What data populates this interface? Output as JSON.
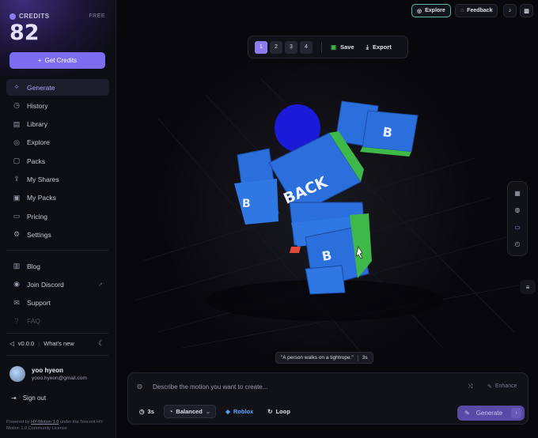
{
  "sidebar": {
    "credits": {
      "label": "CREDITS",
      "plan": "FREE",
      "count": "82",
      "cta": "Get Credits"
    },
    "nav": [
      {
        "label": "Generate",
        "icon": "sparkle-icon",
        "active": true
      },
      {
        "label": "History",
        "icon": "history-icon"
      },
      {
        "label": "Library",
        "icon": "library-icon"
      },
      {
        "label": "Explore",
        "icon": "compass-icon"
      },
      {
        "label": "Packs",
        "icon": "box-icon"
      },
      {
        "label": "My Shares",
        "icon": "share-icon"
      },
      {
        "label": "My Packs",
        "icon": "packs-icon"
      },
      {
        "label": "Pricing",
        "icon": "pricing-icon"
      },
      {
        "label": "Settings",
        "icon": "gear-icon"
      }
    ],
    "nav2": [
      {
        "label": "Blog",
        "icon": "book-icon"
      },
      {
        "label": "Join Discord",
        "icon": "discord-icon"
      },
      {
        "label": "Support",
        "icon": "mail-icon"
      },
      {
        "label": "FAQ",
        "icon": "help-icon"
      }
    ],
    "version": "v0.0.0",
    "whats_new": "What's new",
    "user": {
      "name": "yoo hyeon",
      "email": "yooo.hyeon@gmail.com"
    },
    "sign_out": "Sign out",
    "powered_prefix": "Powered by",
    "powered_link": "HY-Motion 1.0",
    "powered_suffix": "under the Tencent HY-Motion 1.0 Community License"
  },
  "topbar": {
    "explore": "Explore",
    "feedback": "Feedback"
  },
  "toolbar": {
    "pages": [
      "1",
      "2",
      "3",
      "4"
    ],
    "selected_page": "1",
    "save": "Save",
    "export": "Export"
  },
  "scene": {
    "label_back": "BACK",
    "label_b": "B"
  },
  "caption": {
    "text": "\"A person walks on a tightrope.\"",
    "duration": "3s"
  },
  "prompt": {
    "placeholder": "Describe the motion you want to create...",
    "enhance": "Enhance",
    "duration": "3s",
    "quality": "Balanced",
    "platform": "Roblox",
    "loop": "Loop",
    "generate": "Generate"
  },
  "colors": {
    "accent": "#8b7cf0",
    "explore_border": "#5bb8a8",
    "roblox": "#5aa8ff"
  }
}
